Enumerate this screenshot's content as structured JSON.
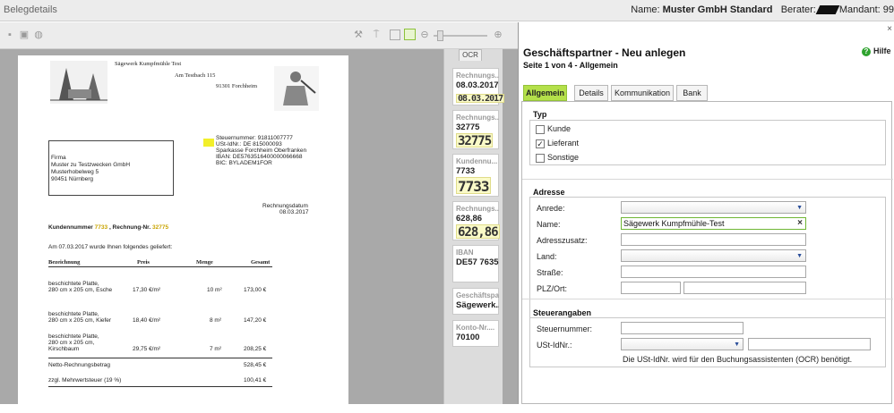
{
  "topbar": {
    "title": "Belegdetails",
    "name_label": "Name:",
    "name_value": "Muster GmbH Standard",
    "berater_label": "Berater:",
    "mandant_label": "Mandant: 99"
  },
  "toolbar": {
    "zoom_out": "⊖",
    "zoom_in": "⊕"
  },
  "document": {
    "company": "Sägewerk Kumpfmühle Test",
    "street": "Am Testbach 115",
    "city": "91301 Forchheim",
    "tax_no": "Steuernummer: 91811007777",
    "vat_id": "USt-IdNr.: DE 815000093",
    "bank": "Sparkasse Forchheim Oberfranken",
    "iban": "IBAN: DE5763516400000066668",
    "bic": "BIC: BYLADEM1FOR",
    "addr": [
      "Firma",
      "Muster zu Testzwecken GmbH",
      "Musterhobelweg 5",
      "90451 Nürnberg"
    ],
    "date_label": "Rechnungsdatum",
    "date_value": "08.03.2017",
    "kunden_label": "Kundennummer",
    "kunden_value": "7733",
    "rech_label": ", Rechnung-Nr.",
    "rech_value": "32775",
    "intro": "Am 07.03.2017 wurde Ihnen folgendes geliefert:",
    "cols": [
      "Bezeichnung",
      "Preis",
      "Menge",
      "Gesamt"
    ],
    "rows": [
      {
        "l1": "beschichtete Platte,",
        "l2": "280 cm x 205 cm, Esche",
        "l3": "",
        "price": "17,30 €/m²",
        "qty": "10 m²",
        "total": "173,00 €"
      },
      {
        "l1": "beschichtete Platte,",
        "l2": "280 cm x 205 cm, Kiefer",
        "l3": "",
        "price": "18,40 €/m²",
        "qty": "8 m²",
        "total": "147,20 €"
      },
      {
        "l1": "beschichtete Platte,",
        "l2": "280 cm x 205 cm,",
        "l3": "Kirschbaum",
        "price": "29,75 €/m²",
        "qty": "7 m²",
        "total": "208,25 €"
      }
    ],
    "net_label": "Netto-Rechnungsbetrag",
    "net_value": "528,45 €",
    "vat_label": "zzgl. Mehrwertsteuer (19 %)",
    "vat_value": "100,41 €"
  },
  "ocr": {
    "tab": "OCR",
    "fields": [
      {
        "label": "Rechnungs...",
        "value": "08.03.2017",
        "img": "08.03.2017"
      },
      {
        "label": "Rechnungs...",
        "value": "32775",
        "img": "32775"
      },
      {
        "label": "Kundennu...",
        "value": "7733",
        "img": "7733"
      },
      {
        "label": "Rechnungs...",
        "value": "628,86",
        "img": "628,86"
      },
      {
        "label": "IBAN",
        "value": "DE57 7635...",
        "img": ""
      },
      {
        "label": "Geschäftspa...",
        "value": "Sägewerk...",
        "img": ""
      },
      {
        "label": "Konto-Nr....",
        "value": "70100",
        "img": ""
      }
    ]
  },
  "form": {
    "close": "×",
    "title": "Geschäftspartner - Neu anlegen",
    "subtitle": "Seite 1 von 4 - Allgemein",
    "help": "Hilfe",
    "tabs": [
      "Allgemein",
      "Details",
      "Kommunikation",
      "Bank"
    ],
    "typ": {
      "heading": "Typ",
      "kunde": "Kunde",
      "lieferant": "Lieferant",
      "sonstige": "Sonstige",
      "checked": "Lieferant"
    },
    "adresse": {
      "heading": "Adresse",
      "anrede": "Anrede:",
      "name": "Name:",
      "name_value": "Sägewerk Kumpfmühle-Test",
      "adresszusatz": "Adresszusatz:",
      "land": "Land:",
      "strasse": "Straße:",
      "plzort": "PLZ/Ort:"
    },
    "steuer": {
      "heading": "Steuerangaben",
      "steuernummer": "Steuernummer:",
      "ustid": "USt-IdNr.:",
      "note": "Die USt-IdNr. wird für den Buchungsassistenten (OCR) benötigt."
    }
  }
}
